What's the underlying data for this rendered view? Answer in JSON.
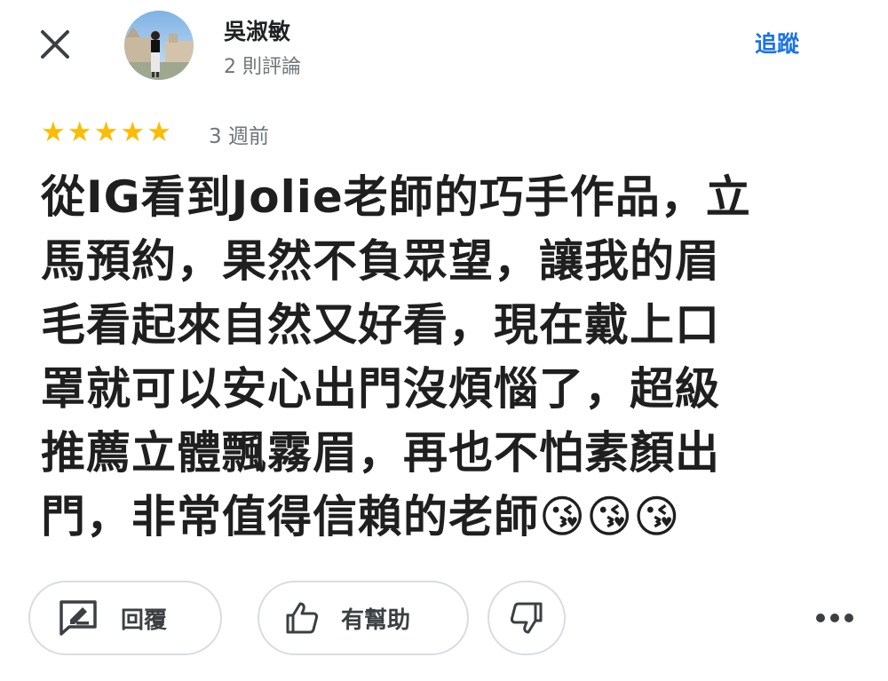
{
  "header": {
    "close_icon": "close-icon",
    "reviewer_name": "吳淑敏",
    "review_count": "2 則評論",
    "follow_label": "追蹤"
  },
  "review": {
    "rating": 5,
    "rating_max": 5,
    "star_color": "#fbbc04",
    "time": "3 週前",
    "lines": [
      "從IG看到Jolie老師的巧手作品，立",
      "馬預約，果然不負眾望，讓我的眉",
      "毛看起來自然又好看，現在戴上口",
      "罩就可以安心出門沒煩惱了，超級",
      "推薦立體飄霧眉，再也不怕素顏出",
      "門，非常值得信賴的老師😘😘😘"
    ]
  },
  "actions": {
    "reply_label": "回覆",
    "reply_icon": "rate-review-icon",
    "helpful_label": "有幫助",
    "helpful_icon": "thumb-up-icon",
    "unhelpful_icon": "thumb-down-icon",
    "more_icon": "more-horizontal-icon"
  },
  "colors": {
    "accent": "#1a73e8",
    "secondary_text": "#70757a"
  }
}
